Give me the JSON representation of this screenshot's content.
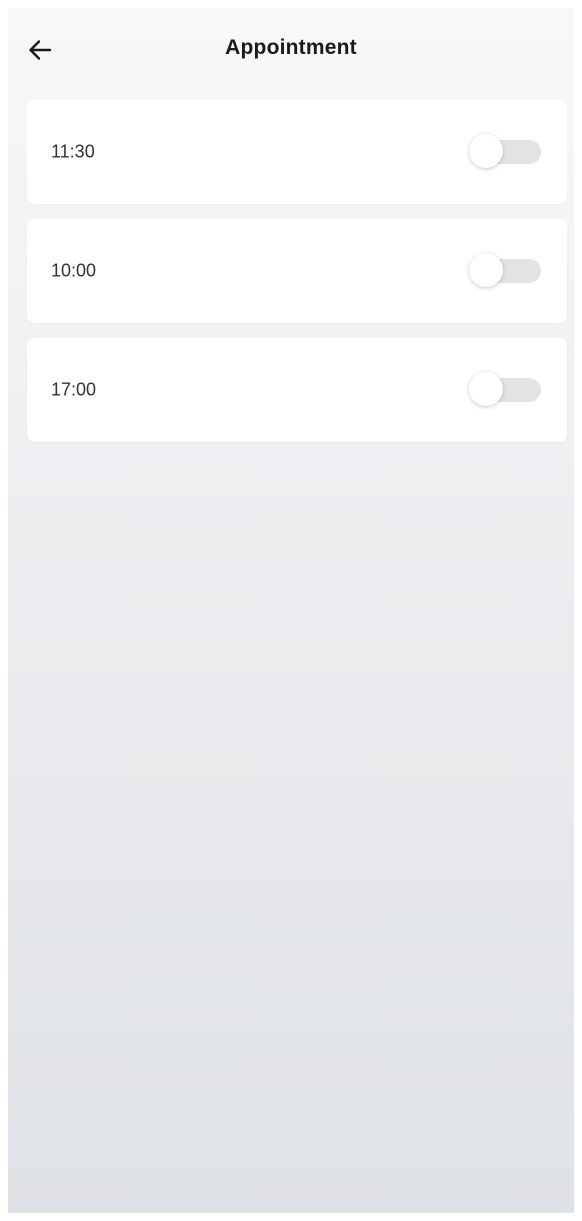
{
  "header": {
    "title": "Appointment",
    "back_icon": "arrow-left-icon"
  },
  "appointments": [
    {
      "time": "11:30",
      "enabled": false
    },
    {
      "time": "10:00",
      "enabled": false
    },
    {
      "time": "17:00",
      "enabled": false
    }
  ],
  "colors": {
    "title_text": "#1a1a1a",
    "item_text": "#333333",
    "card_background": "#ffffff",
    "toggle_track_off": "#e3e3e3",
    "screen_background_top": "#f8f8f9",
    "screen_background_bottom": "#dfe2e6"
  }
}
